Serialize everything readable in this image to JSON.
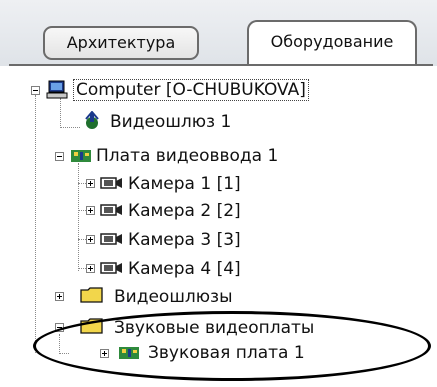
{
  "tabs": [
    {
      "label": "Архитектура",
      "active": false
    },
    {
      "label": "Оборудование",
      "active": true
    }
  ],
  "tree": {
    "root": {
      "label": "Computer [O-CHUBUKOVA]",
      "icon": "computer-icon",
      "expanded": true
    },
    "videogateway": {
      "label": "Видеошлюз 1",
      "icon": "videogateway-icon"
    },
    "capture_board": {
      "label": "Плата видеоввода 1",
      "icon": "board-icon",
      "expanded": true
    },
    "cameras": [
      {
        "label": "Камера 1 [1]",
        "icon": "camera-icon"
      },
      {
        "label": "Камера 2 [2]",
        "icon": "camera-icon"
      },
      {
        "label": "Камера 3 [3]",
        "icon": "camera-icon"
      },
      {
        "label": "Камера 4 [4]",
        "icon": "camera-icon"
      }
    ],
    "videogateways_folder": {
      "label": "Видеошлюзы",
      "icon": "folder-icon",
      "expanded": false
    },
    "sound_boards_folder": {
      "label": "Звуковые видеоплаты",
      "icon": "folder-icon",
      "expanded": true
    },
    "sound_board": {
      "label": "Звуковая плата 1",
      "icon": "board-icon"
    }
  },
  "colors": {
    "highlight_ellipse": "#000000",
    "board_green": "#2f8a3c",
    "folder_yellow": "#f2d64b"
  }
}
